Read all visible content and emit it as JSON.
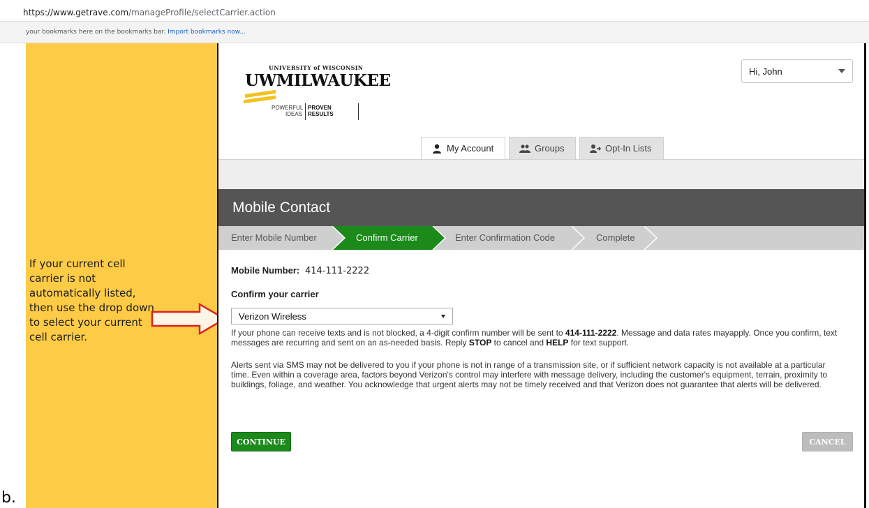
{
  "browser": {
    "url_host": "https://www.getrave.com",
    "url_path": "/manageProfile/selectCarrier.action",
    "bookmarks_text": "your bookmarks here on the bookmarks bar.",
    "bookmarks_link": "Import bookmarks now..."
  },
  "annotation": {
    "note": "If your current cell carrier is not automatically listed, then use the drop down to select your current cell carrier.",
    "label": "b."
  },
  "logo": {
    "top": "UNIVERSITY of WISCONSIN",
    "main": "UWMILWAUKEE",
    "tag1_line1": "POWERFUL",
    "tag1_line2": "IDEAS",
    "tag2_line1": "PROVEN",
    "tag2_line2": "RESULTS",
    "stripe_color": "#f3c21d"
  },
  "user_menu": {
    "greeting": "Hi,",
    "name": "John"
  },
  "tabs": [
    {
      "label": "My Account",
      "icon": "user-icon",
      "active": true
    },
    {
      "label": "Groups",
      "icon": "users-icon",
      "active": false
    },
    {
      "label": "Opt-In Lists",
      "icon": "user-add-icon",
      "active": false
    }
  ],
  "mobile_contact": {
    "title": "Mobile Contact",
    "steps": [
      "Enter Mobile Number",
      "Confirm Carrier",
      "Enter Confirmation Code",
      "Complete"
    ],
    "active_step": "Confirm Carrier",
    "mobile_number_label": "Mobile Number:",
    "mobile_number_value": "414-111-2222",
    "confirm_carrier_label": "Confirm your carrier",
    "carrier_selected": "Verizon Wireless",
    "para1_a": "If your phone can receive texts and is not blocked, a 4-digit confirm number will be sent to ",
    "para1_number": "414-111-2222",
    "para1_b": ". Message and data rates mayapply. Once you confirm, text messages are recurring and sent on an as-needed basis. Reply ",
    "para1_stop": "STOP",
    "para1_c": " to cancel and ",
    "para1_help": "HELP",
    "para1_d": " for text support.",
    "para2": "Alerts sent via SMS may not be delivered to you if your phone is not in range of a transmission site, or if sufficient network capacity is not available at a particular time. Even within a coverage area, factors beyond Verizon's control may interfere with message delivery, including the customer's equipment, terrain, proximity to buildings, foliage, and weather. You acknowledge that urgent alerts may not be timely received and that Verizon does not guarantee that alerts will be delivered.",
    "continue_label": "CONTINUE",
    "cancel_label": "CANCEL"
  },
  "colors": {
    "annotation_bg": "#fecb47",
    "header_bg": "#555555",
    "step_active": "#1b8a1b",
    "step_bar": "#cfcfcf",
    "continue_bg": "#1b8a1b",
    "cancel_bg": "#bdbdbd",
    "arrow": "#e02020"
  }
}
